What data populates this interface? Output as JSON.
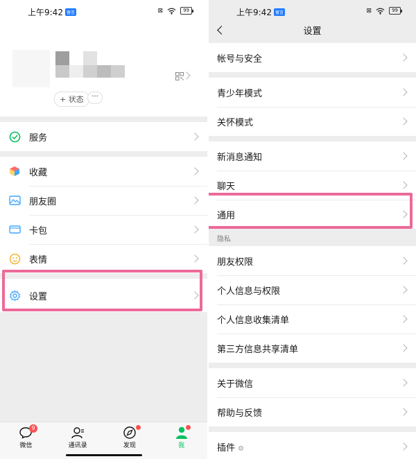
{
  "status": {
    "time": "上午9:42",
    "badge": "留言",
    "battery": "99",
    "x_icon": "⊠"
  },
  "left": {
    "profile": {
      "status_label": "+ 状态",
      "more_label": "···"
    },
    "services": [
      {
        "icon": "service-icon",
        "label": "服务"
      }
    ],
    "items": [
      {
        "icon": "favorites-icon",
        "label": "收藏"
      },
      {
        "icon": "moments-icon",
        "label": "朋友圈"
      },
      {
        "icon": "cards-icon",
        "label": "卡包"
      },
      {
        "icon": "emoji-icon",
        "label": "表情"
      }
    ],
    "settings": {
      "icon": "gear-icon",
      "label": "设置"
    },
    "tabs": [
      {
        "icon": "chat-icon",
        "label": "微信",
        "badge": "9"
      },
      {
        "icon": "contacts-icon",
        "label": "通讯录"
      },
      {
        "icon": "discover-icon",
        "label": "发现"
      },
      {
        "icon": "me-icon",
        "label": "我"
      }
    ],
    "accent": "#07c160"
  },
  "right": {
    "title": "设置",
    "group1": [
      "帐号与安全"
    ],
    "group2": [
      "青少年模式",
      "关怀模式"
    ],
    "group3": [
      "新消息通知",
      "聊天",
      "通用"
    ],
    "privacy_label": "隐私",
    "group4": [
      "朋友权限",
      "个人信息与权限",
      "个人信息收集清单",
      "第三方信息共享清单"
    ],
    "group5": [
      "关于微信",
      "帮助与反馈"
    ],
    "group6": [
      "插件"
    ],
    "plugin_icon": "⚙"
  },
  "highlight_color": "#ec6a99"
}
